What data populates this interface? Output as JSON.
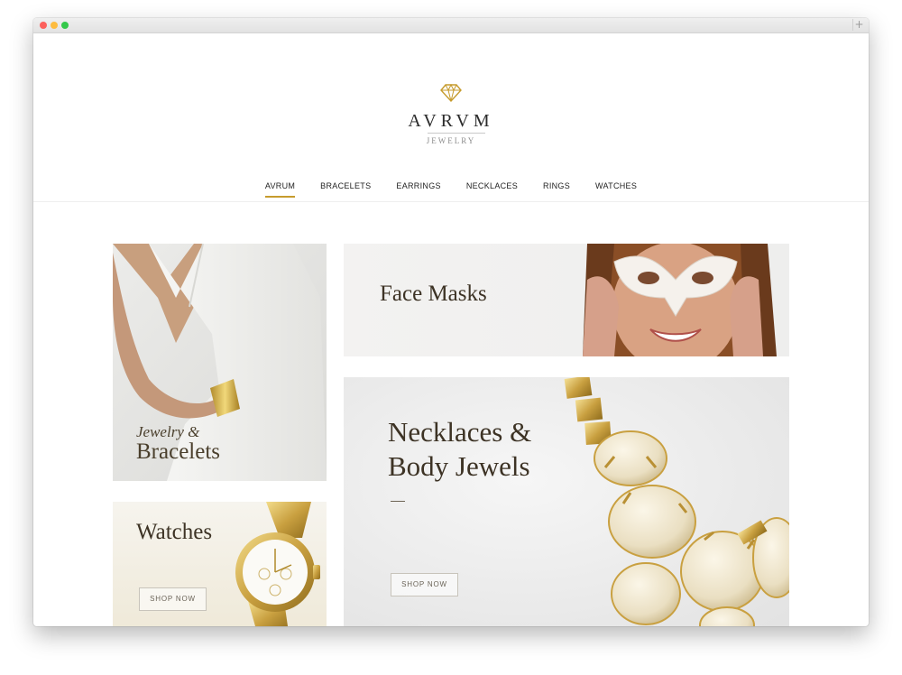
{
  "brand": {
    "name": "AVRVM",
    "subtitle": "JEWELRY"
  },
  "nav": {
    "items": [
      {
        "label": "AVRUM",
        "active": true
      },
      {
        "label": "BRACELETS",
        "active": false
      },
      {
        "label": "EARRINGS",
        "active": false
      },
      {
        "label": "NECKLACES",
        "active": false
      },
      {
        "label": "RINGS",
        "active": false
      },
      {
        "label": "WATCHES",
        "active": false
      }
    ]
  },
  "cards": {
    "bracelets": {
      "line1": "Jewelry &",
      "line2": "Bracelets"
    },
    "watches": {
      "title": "Watches",
      "button": "SHOP NOW"
    },
    "masks": {
      "title": "Face Masks"
    },
    "necklaces": {
      "line1": "Necklaces &",
      "line2": "Body Jewels",
      "button": "SHOP NOW"
    }
  },
  "colors": {
    "accent": "#c69b2d",
    "heading": "#3d3325"
  }
}
